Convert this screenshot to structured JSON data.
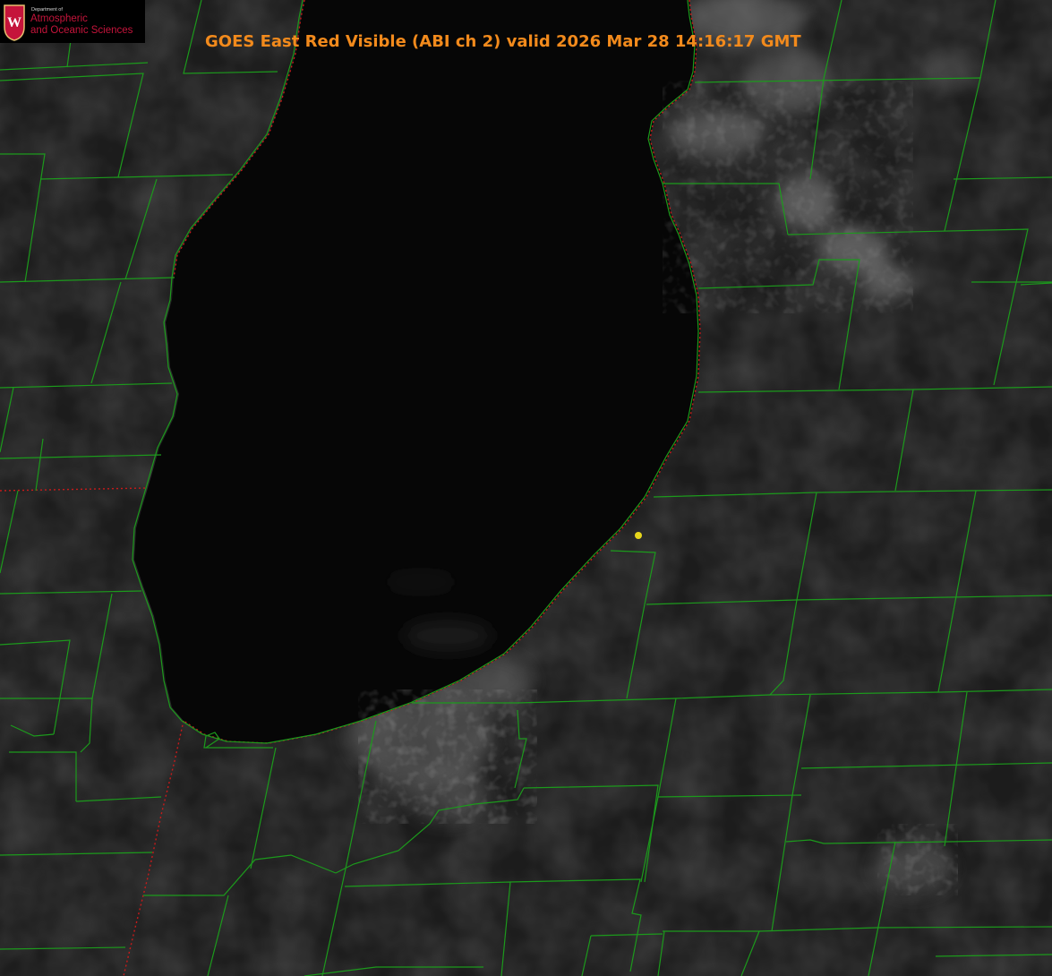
{
  "title": "GOES East Red Visible (ABI ch 2) valid 2026 Mar 28 14:16:17 GMT",
  "logo": {
    "department": "Department of",
    "line1": "Atmospheric",
    "line2": "and Oceanic Sciences",
    "crest_letter": "W"
  },
  "colors": {
    "title": "#f28a1c",
    "county_lines": "#1c9a1c",
    "state_line": "#c81a1a",
    "marker": "#e6d61c",
    "logo_text": "#c5143b",
    "lake": "#060606",
    "land": "#1c1c1c"
  },
  "features": [
    "lake-michigan",
    "county-boundaries",
    "state-boundaries",
    "coastline",
    "cloud-cover",
    "site-marker"
  ]
}
